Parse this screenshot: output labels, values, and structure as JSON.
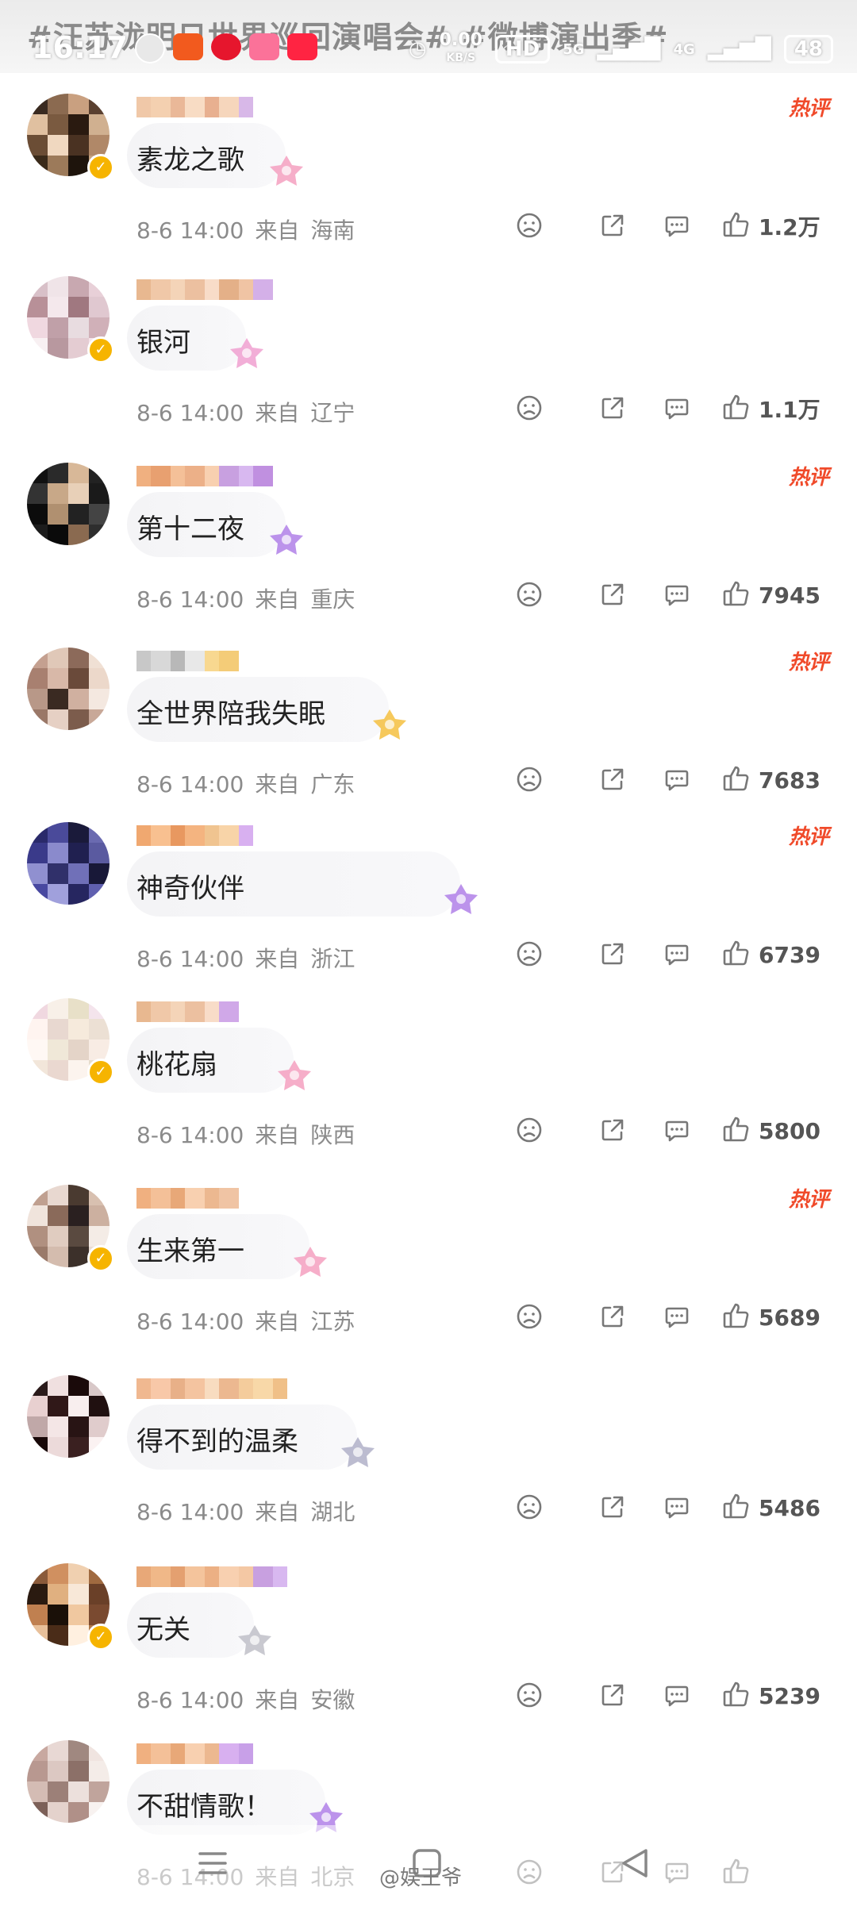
{
  "status_bar": {
    "time": "16:17",
    "network_speed": "0.00",
    "network_unit": "KB/S",
    "hd": "HD",
    "net_5g": "5G",
    "net_4g": "4G",
    "battery": "48"
  },
  "header": {
    "hashtags": "#汪苏泷明日世界巡回演唱会# #微博演出季#"
  },
  "hot_label": "热评",
  "from_label": "来自",
  "comments": [
    {
      "text": "素龙之歌",
      "date": "8-6 14:00",
      "location": "海南",
      "likes": "1.2万",
      "hot": true
    },
    {
      "text": "银河",
      "date": "8-6 14:00",
      "location": "辽宁",
      "likes": "1.1万",
      "hot": false
    },
    {
      "text": "第十二夜",
      "date": "8-6 14:00",
      "location": "重庆",
      "likes": "7945",
      "hot": true
    },
    {
      "text": "全世界陪我失眠",
      "date": "8-6 14:00",
      "location": "广东",
      "likes": "7683",
      "hot": true
    },
    {
      "text": "神奇伙伴",
      "date": "8-6 14:00",
      "location": "浙江",
      "likes": "6739",
      "hot": true
    },
    {
      "text": "桃花扇",
      "date": "8-6 14:00",
      "location": "陕西",
      "likes": "5800",
      "hot": false
    },
    {
      "text": "生来第一",
      "date": "8-6 14:00",
      "location": "江苏",
      "likes": "5689",
      "hot": true
    },
    {
      "text": "得不到的温柔",
      "date": "8-6 14:00",
      "location": "湖北",
      "likes": "5486",
      "hot": false
    },
    {
      "text": "无关",
      "date": "8-6 14:00",
      "location": "安徽",
      "likes": "5239",
      "hot": false
    },
    {
      "text": "不甜情歌！",
      "date": "8-6 14:00",
      "location": "北京",
      "likes": "",
      "hot": false
    }
  ],
  "watermark": "@娱王爷",
  "colors": {
    "hot": "#f04a2a",
    "meta": "#8b8b8b",
    "vip_badge": "#f6b400"
  }
}
